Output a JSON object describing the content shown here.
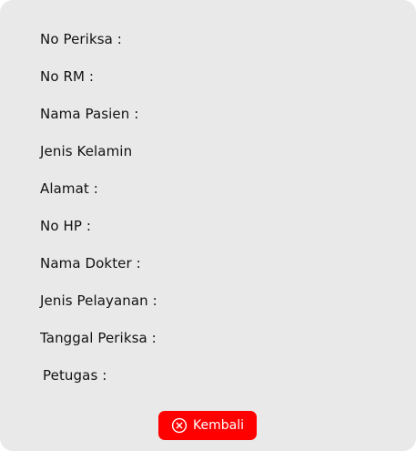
{
  "fields": [
    {
      "label": "No Periksa :"
    },
    {
      "label": "No RM :"
    },
    {
      "label": "Nama Pasien :"
    },
    {
      "label": "Jenis Kelamin"
    },
    {
      "label": "Alamat :"
    },
    {
      "label": "No HP :"
    },
    {
      "label": "Nama Dokter :"
    },
    {
      "label": "Jenis Pelayanan :"
    },
    {
      "label": "Tanggal Periksa :"
    },
    {
      "label": "Petugas :"
    }
  ],
  "back_button": {
    "label": "Kembali",
    "icon": "close-circle-icon",
    "color": "#ff0000"
  },
  "card": {
    "background": "#e9e9e9"
  }
}
